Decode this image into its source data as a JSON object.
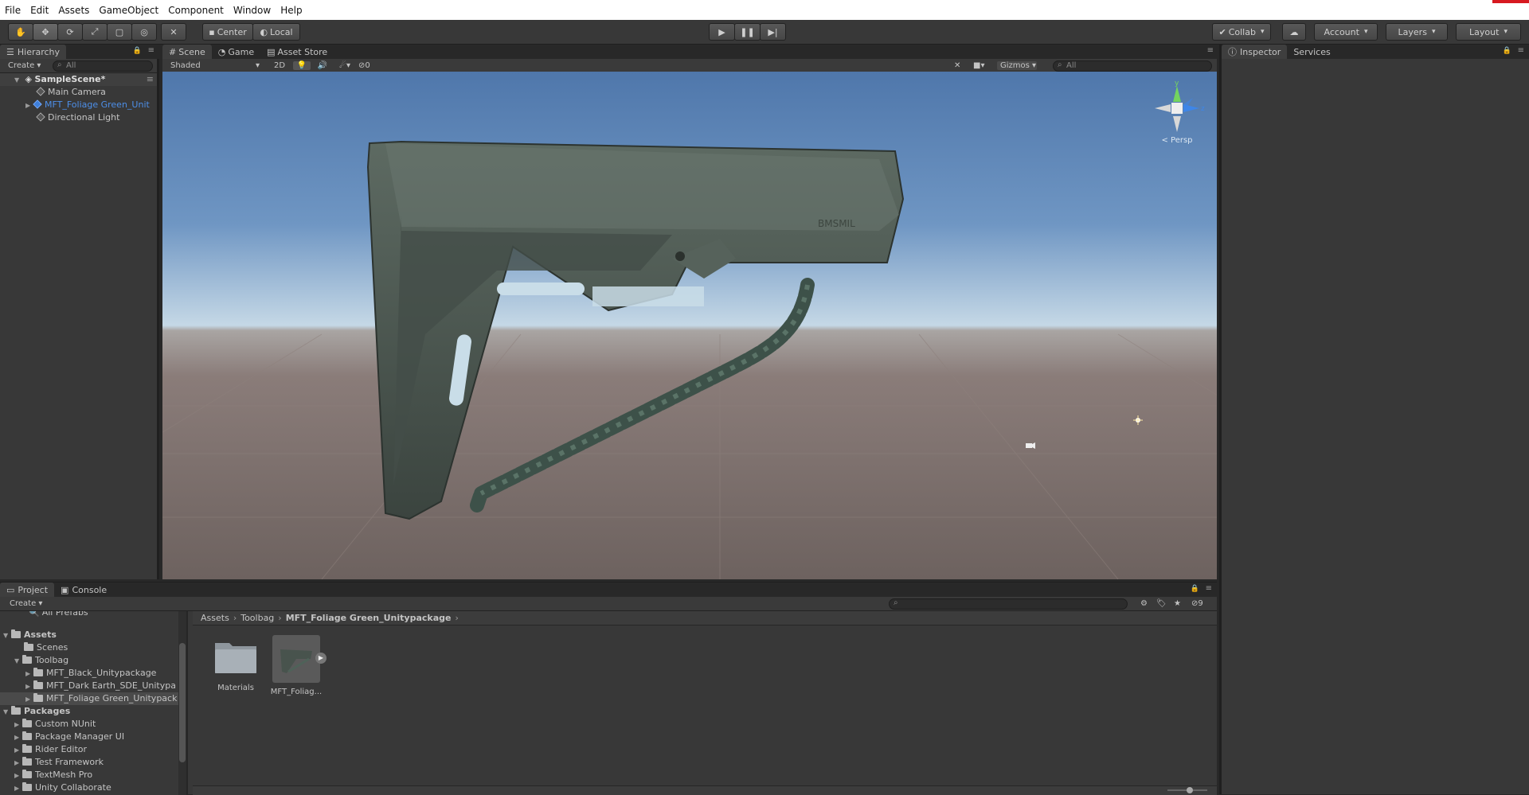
{
  "menu": [
    "File",
    "Edit",
    "Assets",
    "GameObject",
    "Component",
    "Window",
    "Help"
  ],
  "toolbar": {
    "tools": [
      "hand-tool",
      "move-tool",
      "rotate-tool",
      "scale-tool",
      "rect-tool",
      "transform-tool",
      "custom-tool"
    ],
    "pivot": "Center",
    "space": "Local",
    "collab": "Collab",
    "account": "Account",
    "layers": "Layers",
    "layout": "Layout"
  },
  "hierarchy": {
    "tab": "Hierarchy",
    "create": "Create",
    "search_placeholder": "All",
    "scene": "SampleScene*",
    "items": [
      "Main Camera",
      "MFT_Foliage Green_Unit",
      "Directional Light"
    ],
    "selected_color": "#4d8fe8"
  },
  "scene_tabs": [
    "Scene",
    "Game",
    "Asset Store"
  ],
  "scene_toolbar": {
    "shading": "Shaded",
    "mode_2d": "2D",
    "hidden_count": "0",
    "gizmos": "Gizmos",
    "search_placeholder": "All"
  },
  "gizmo": {
    "y": "y",
    "z": "z",
    "persp": "Persp"
  },
  "viewport": {
    "stamp_text": "BMSMIL"
  },
  "inspector_tabs": [
    "Inspector",
    "Services"
  ],
  "bottom_tabs": [
    "Project",
    "Console"
  ],
  "project": {
    "create": "Create",
    "favorites_partial": "All Prefabs",
    "tree": [
      {
        "label": "Assets",
        "level": 0,
        "bold": true,
        "expanded": true
      },
      {
        "label": "Scenes",
        "level": 1
      },
      {
        "label": "Toolbag",
        "level": 1,
        "expanded": true
      },
      {
        "label": "MFT_Black_Unitypackage",
        "level": 2
      },
      {
        "label": "MFT_Dark Earth_SDE_Unitypa",
        "level": 2
      },
      {
        "label": "MFT_Foliage Green_Unitypack",
        "level": 2,
        "selected": true
      },
      {
        "label": "Packages",
        "level": 0,
        "bold": true,
        "expanded": true
      },
      {
        "label": "Custom NUnit",
        "level": 1
      },
      {
        "label": "Package Manager UI",
        "level": 1
      },
      {
        "label": "Rider Editor",
        "level": 1
      },
      {
        "label": "Test Framework",
        "level": 1
      },
      {
        "label": "TextMesh Pro",
        "level": 1
      },
      {
        "label": "Unity Collaborate",
        "level": 1
      }
    ],
    "breadcrumb": [
      "Assets",
      "Toolbag",
      "MFT_Foliage Green_Unitypackage"
    ],
    "assets": [
      {
        "label": "Materials",
        "kind": "folder"
      },
      {
        "label": "MFT_Foliag...",
        "kind": "prefab"
      }
    ],
    "hidden_count": "9"
  }
}
